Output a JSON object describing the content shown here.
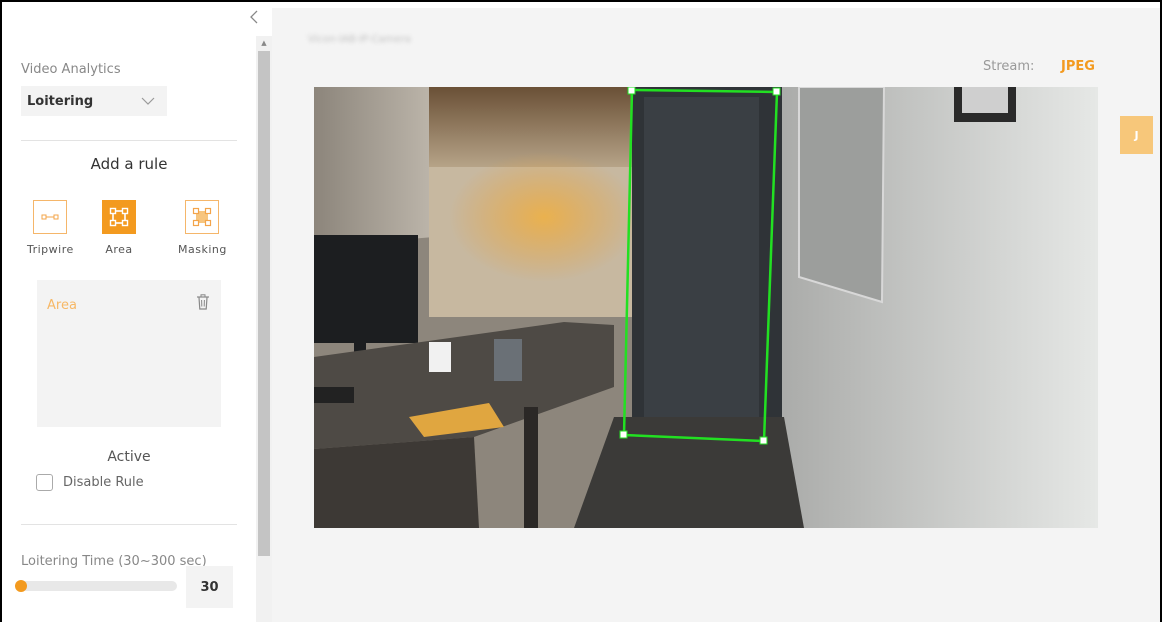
{
  "sidebar": {
    "collapse_icon": "chevron-left-icon",
    "video_analytics_label": "Video Analytics",
    "analytics_select_value": "Loitering",
    "add_rule_title": "Add a rule",
    "tools": [
      {
        "label": "Tripwire",
        "icon": "tripwire-icon",
        "active": false
      },
      {
        "label": "Area",
        "icon": "area-icon",
        "active": true
      },
      {
        "label": "Masking",
        "icon": "masking-icon",
        "active": false
      }
    ],
    "rule_card": {
      "name": "Area",
      "delete_icon": "trash-icon"
    },
    "active_label": "Active",
    "disable_rule_label": "Disable Rule",
    "disable_rule_checked": false,
    "loitering_label": "Loitering Time (30~300 sec)",
    "loitering_min": 30,
    "loitering_max": 300,
    "loitering_value": "30"
  },
  "main": {
    "camera_name": "Vicon-IAB-IP-Camera",
    "stream_label": "Stream:",
    "stream_value": "JPEG",
    "avatar_letter": "J"
  },
  "colors": {
    "accent": "#f39a1f",
    "rule_zone": "#22e022"
  }
}
